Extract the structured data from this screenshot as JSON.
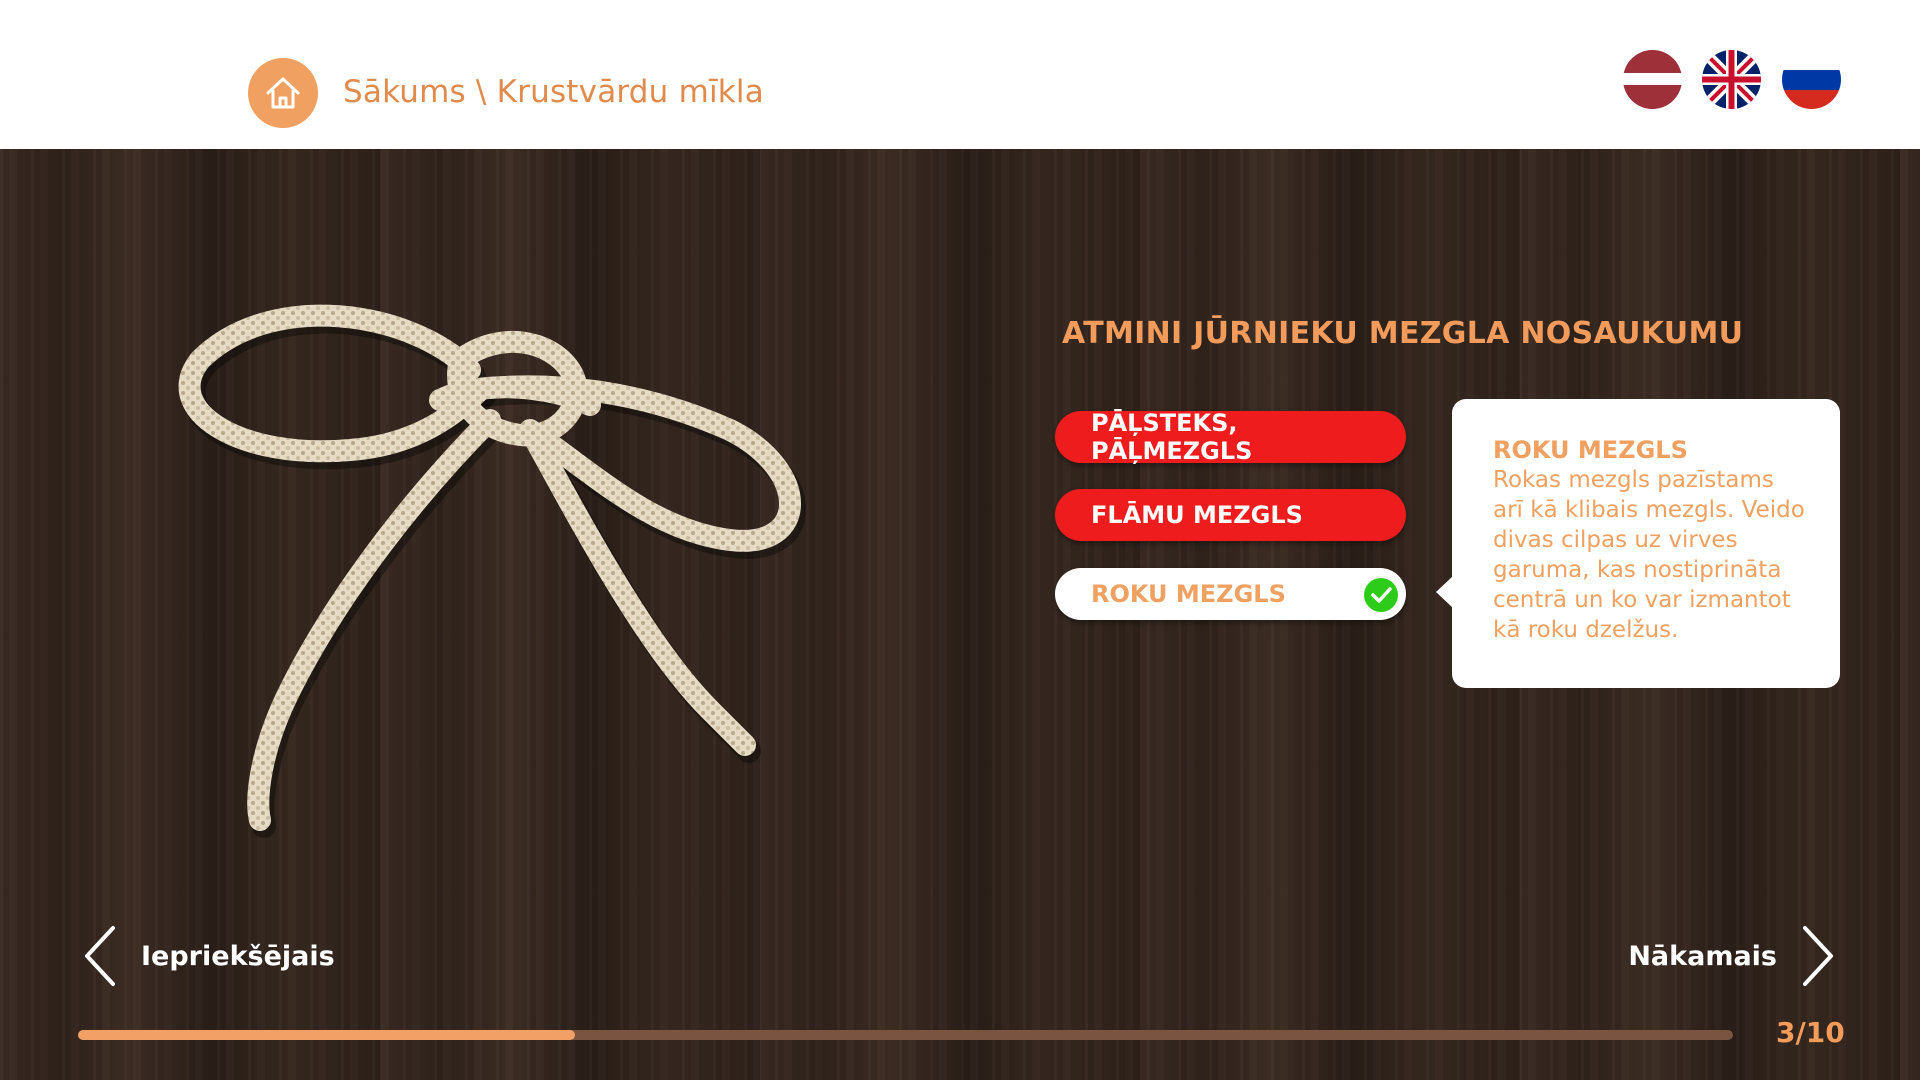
{
  "header": {
    "breadcrumb": "Sākums \\ Krustvārdu mīkla",
    "home_icon": "house-icon",
    "languages": [
      {
        "code": "lv",
        "icon": "flag-latvia-icon"
      },
      {
        "code": "en",
        "icon": "flag-uk-icon"
      },
      {
        "code": "ru",
        "icon": "flag-russia-icon"
      }
    ]
  },
  "quiz": {
    "question": "ATMINI JŪRNIEKU MEZGLA NOSAUKUMU",
    "answers": [
      {
        "label": "PĀĻSTEKS, PĀĻMEZGLS",
        "state": "wrong"
      },
      {
        "label": "FLĀMU MEZGLS",
        "state": "wrong"
      },
      {
        "label": "ROKU MEZGLS",
        "state": "correct"
      }
    ],
    "info": {
      "title": "ROKU MEZGLS",
      "text": "Rokas mezgls pazīstams arī kā klibais mezgls. Veido divas cilpas uz virves garuma, kas nostiprināta centrā un ko var izmantot kā roku dzelžus."
    }
  },
  "navigation": {
    "prev_label": "Iepriekšējais",
    "next_label": "Nākamais"
  },
  "progress": {
    "current": 3,
    "total": 10,
    "counter_text": "3/10"
  },
  "colors": {
    "accent": "#f0a060",
    "wrong": "#ee1c1c",
    "correct_check": "#2ecc1a"
  }
}
